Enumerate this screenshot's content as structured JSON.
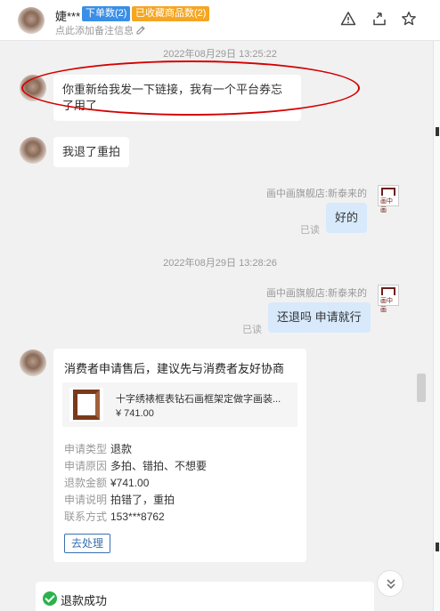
{
  "header": {
    "user_name": "婕***",
    "badge_orders": "下单数(2)",
    "badge_favorites": "已收藏商品数(2)",
    "remark_placeholder": "点此添加备注信息"
  },
  "messages": {
    "ts1": "2022年08月29日 13:25:22",
    "m1": "你重新给我发一下链接，我有一个平台券忘了用了",
    "m2": "我退了重拍",
    "shop_name_1": "画中画旗舰店:新泰来的",
    "m3": "好的",
    "read_1": "已读",
    "ts2": "2022年08月29日 13:28:26",
    "shop_name_2": "画中画旗舰店:新泰来的",
    "m4": "还退吗 申请就行",
    "read_2": "已读",
    "logo_text": "画中画"
  },
  "refund_card": {
    "title": "消费者申请售后，建议先与消费者友好协商",
    "product_name": "十字绣裱框表钻石画框架定做字画装...",
    "product_price": "¥ 741.00",
    "rows": [
      {
        "key": "申请类型",
        "value": "退款"
      },
      {
        "key": "申请原因",
        "value": "多拍、错拍、不想要"
      },
      {
        "key": "退款金额",
        "value": "¥741.00"
      },
      {
        "key": "申请说明",
        "value": "拍错了，重拍"
      },
      {
        "key": "联系方式",
        "value": "153***8762"
      }
    ],
    "action_label": "去处理"
  },
  "status_card": {
    "label": "退款成功"
  },
  "icons": [
    "warning-icon",
    "share-icon",
    "star-icon",
    "edit-icon",
    "chevron-double-down-icon",
    "check-circle-icon"
  ]
}
